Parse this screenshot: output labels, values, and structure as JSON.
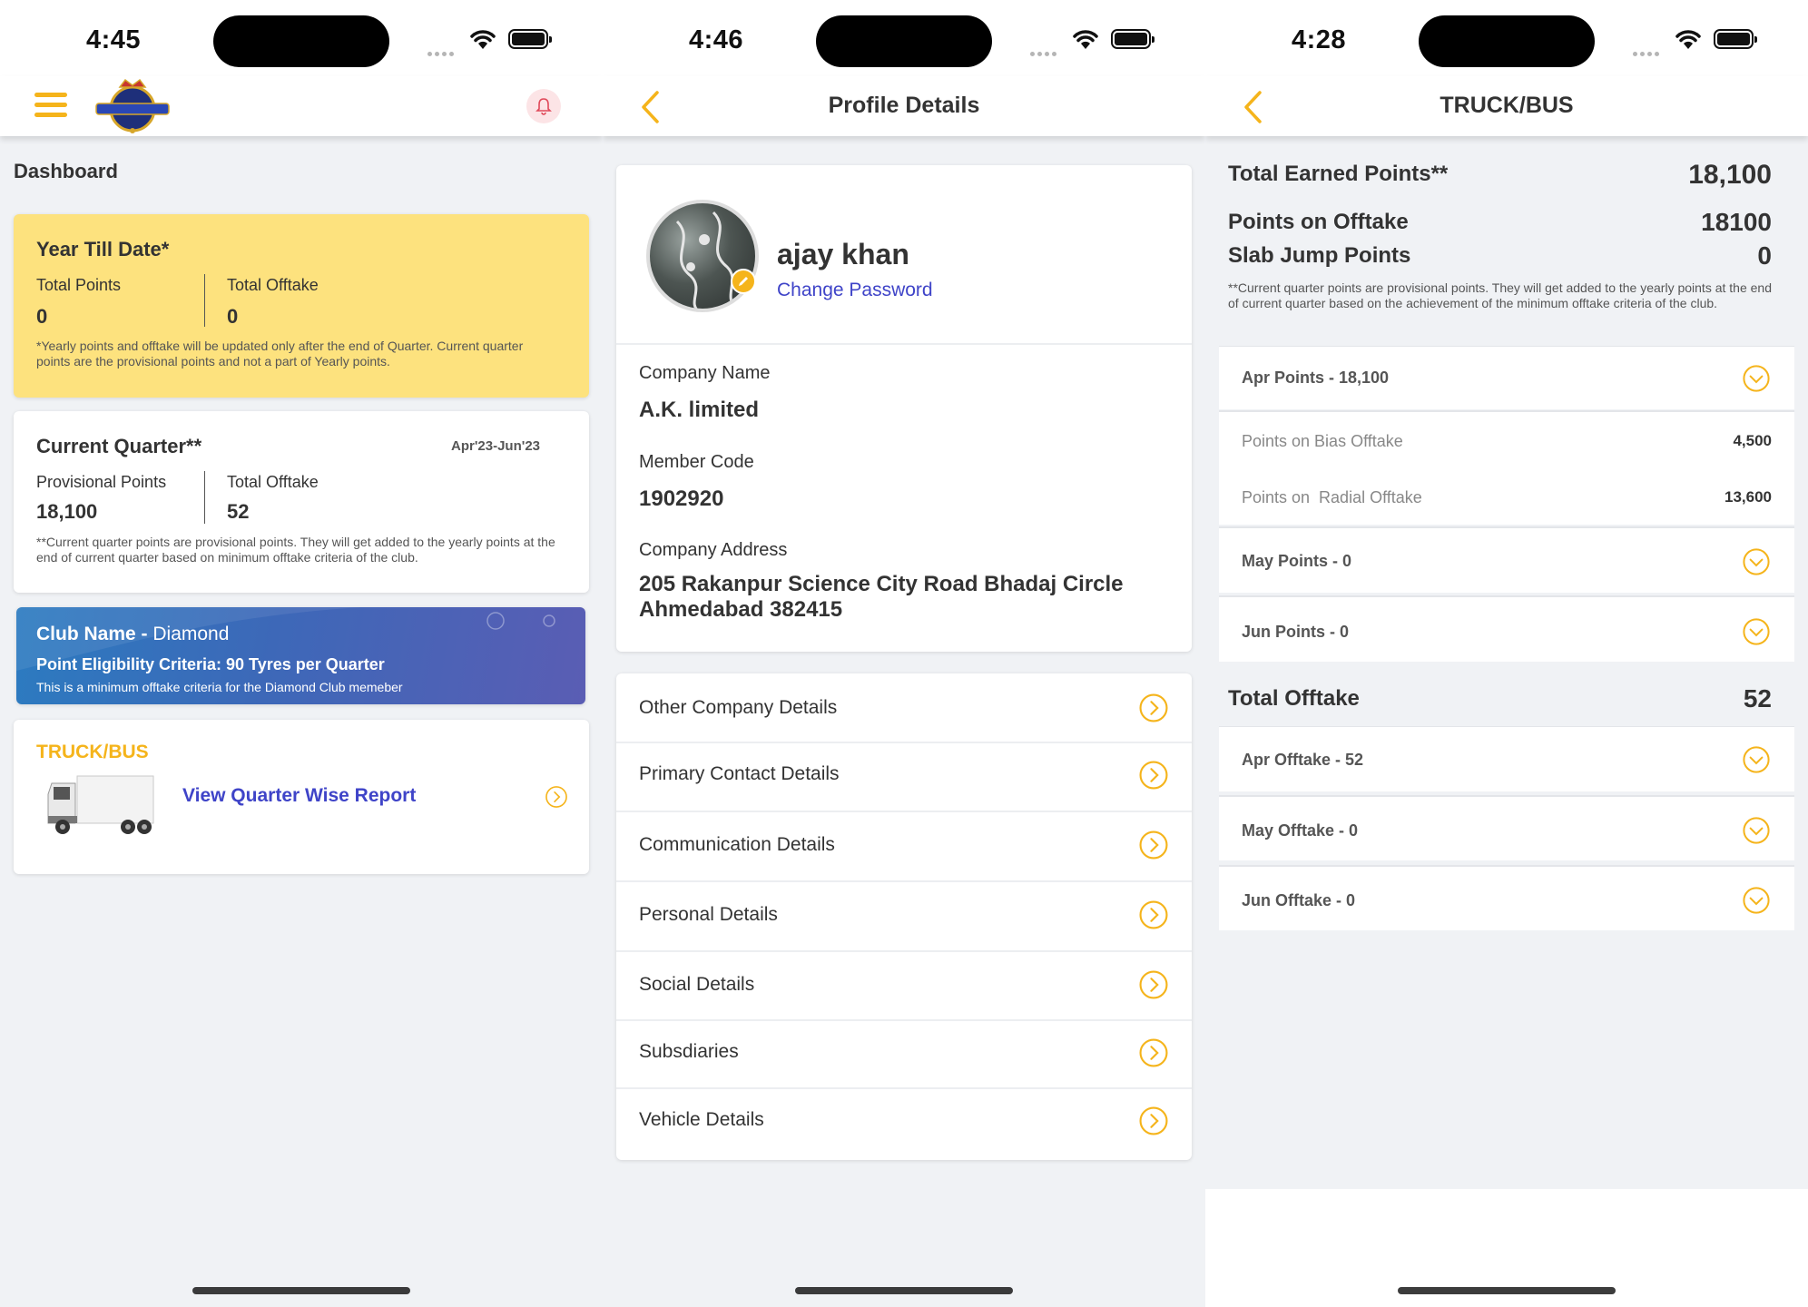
{
  "colors": {
    "accent": "#f5b41b",
    "yellow_card": "#fde27e",
    "link": "#3f44c8",
    "club_gradient_start": "#2c7bc0",
    "club_gradient_end": "#5a5db4"
  },
  "screen1": {
    "time": "4:45",
    "header": {
      "menu_icon": "hamburger-icon",
      "logo": "brand-logo",
      "notification_icon": "bell-icon"
    },
    "section_title": "Dashboard",
    "ytd": {
      "title": "Year Till Date*",
      "total_points_label": "Total Points",
      "total_points": "0",
      "total_offtake_label": "Total Offtake",
      "total_offtake": "0",
      "note": "*Yearly points and offtake will be updated only after the end of Quarter. Current quarter points are the provisional points and not a part of Yearly points."
    },
    "current_quarter": {
      "title": "Current Quarter**",
      "range": "Apr'23-Jun'23",
      "provisional_label": "Provisional Points",
      "provisional_value": "18,100",
      "offtake_label": "Total Offtake",
      "offtake_value": "52",
      "note": "**Current quarter points are provisional points. They will get added to the yearly points at the end of current quarter based on minimum offtake criteria of the club."
    },
    "club": {
      "label": "Club Name - ",
      "name": "Diamond",
      "criteria": "Point Eligibility Criteria: 90 Tyres per Quarter",
      "note": "This is a minimum offtake criteria for the Diamond Club memeber"
    },
    "truck": {
      "title": "TRUCK/BUS",
      "link": "View Quarter Wise Report"
    }
  },
  "screen2": {
    "time": "4:46",
    "title": "Profile Details",
    "name": "ajay khan",
    "change_password": "Change Password",
    "company_name_label": "Company Name",
    "company_name": "A.K. limited",
    "member_code_label": "Member Code",
    "member_code": "1902920",
    "address_label": "Company Address",
    "address": "205 Rakanpur Science City Road Bhadaj Circle Ahmedabad 382415",
    "menu": [
      "Other Company Details",
      "Primary Contact Details",
      "Communication Details",
      "Personal Details",
      "Social Details",
      "Subsdiaries",
      "Vehicle Details"
    ]
  },
  "screen3": {
    "time": "4:28",
    "title": "TRUCK/BUS",
    "total_earned_label": "Total Earned Points**",
    "total_earned": "18,100",
    "offtake_points_label": "Points on Offtake",
    "offtake_points": "18100",
    "slab_label": "Slab Jump Points",
    "slab": "0",
    "note": "**Current quarter points are provisional points. They will get added to the yearly points at the end of current quarter based on the achievement of the minimum offtake criteria of the club.",
    "apr_points": "Apr Points - 18,100",
    "bias_label": "Points on Bias Offtake",
    "bias_value": "4,500",
    "radial_label": "Points on  Radial Offtake",
    "radial_value": "13,600",
    "may_points": "May Points - 0",
    "jun_points": "Jun Points - 0",
    "total_offtake_label": "Total Offtake",
    "total_offtake": "52",
    "apr_offtake": "Apr Offtake - 52",
    "may_offtake": "May Offtake - 0",
    "jun_offtake": "Jun Offtake - 0"
  }
}
